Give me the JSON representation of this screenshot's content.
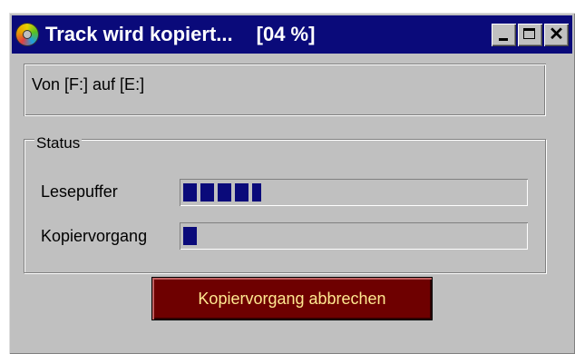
{
  "window": {
    "title": "Track wird kopiert...",
    "title_percent": "[04 %]",
    "icon": "cd-icon",
    "controls": {
      "minimize": "minimize-icon",
      "maximize": "maximize-icon",
      "close": "✕"
    }
  },
  "path_text": "Von [F:] auf [E:]",
  "status": {
    "legend": "Status",
    "read_buffer": {
      "label": "Lesepuffer",
      "progress": 0.23
    },
    "copy_process": {
      "label": "Kopiervorgang",
      "progress": 0.04
    }
  },
  "cancel_button": "Kopiervorgang abbrechen",
  "colors": {
    "titlebar": "#0a0a7a",
    "progress": "#0a0a7a",
    "button_bg": "#6e0000",
    "button_text": "#ffe890",
    "face": "#c0c0c0"
  }
}
